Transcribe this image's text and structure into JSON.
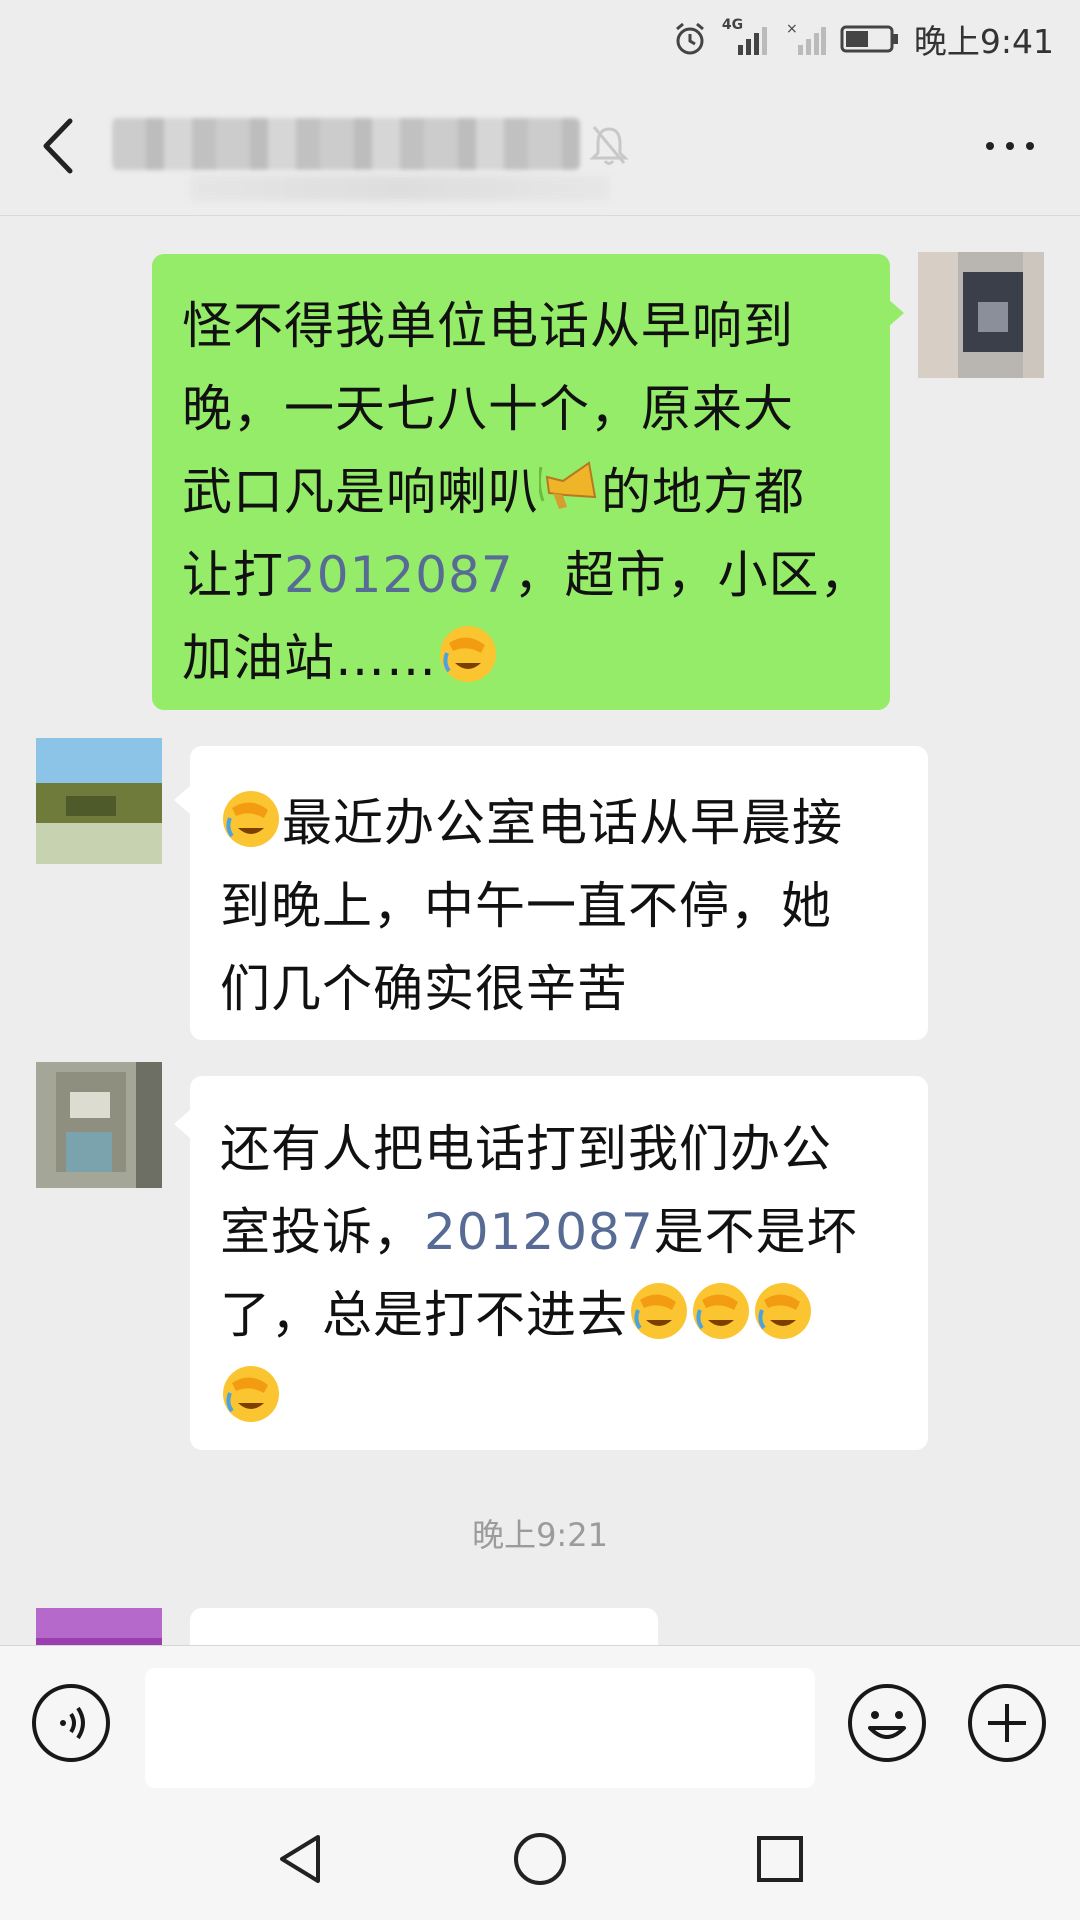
{
  "status_bar": {
    "time": "晚上9:41",
    "network_label": "4G",
    "icons": [
      "alarm-icon",
      "signal-4g-icon",
      "no-signal-icon",
      "battery-icon"
    ]
  },
  "header": {
    "title": "",
    "icons": [
      "back-arrow-icon",
      "mute-bell-icon",
      "more-dots-icon"
    ]
  },
  "messages": [
    {
      "direction": "out",
      "lines": [
        "怪不得我单位电话从早响到",
        "晚，一天七八十个，原来大",
        "武口凡是响喇叭",
        "的地方都",
        "让打",
        "2012087",
        "，超市，小区，",
        "加油站……"
      ],
      "emojis": [
        "loudspeaker-emoji",
        "facepalm-emoji"
      ]
    },
    {
      "direction": "in",
      "lines": [
        "最近办公室电话从早晨接",
        "到晚上，中午一直不停，她",
        "们几个确实很辛苦"
      ],
      "emojis": [
        "facepalm-emoji"
      ]
    },
    {
      "direction": "in",
      "lines": [
        "还有人把电话打到我们办公",
        "室投诉，",
        "2012087",
        "是不是坏",
        "了，总是打不进去"
      ],
      "emojis": [
        "facepalm-emoji",
        "facepalm-emoji",
        "facepalm-emoji",
        "facepalm-emoji"
      ]
    }
  ],
  "timestamp": "晚上9:21",
  "input_bar": {
    "value": "",
    "icons": [
      "voice-icon",
      "emoji-icon",
      "plus-icon"
    ]
  },
  "nav_bar": {
    "icons": [
      "nav-back-icon",
      "nav-home-icon",
      "nav-recent-icon"
    ]
  },
  "colors": {
    "background": "#ededed",
    "outgoing_bubble": "#95ec69",
    "incoming_bubble": "#ffffff",
    "number_link": "#576b95"
  }
}
